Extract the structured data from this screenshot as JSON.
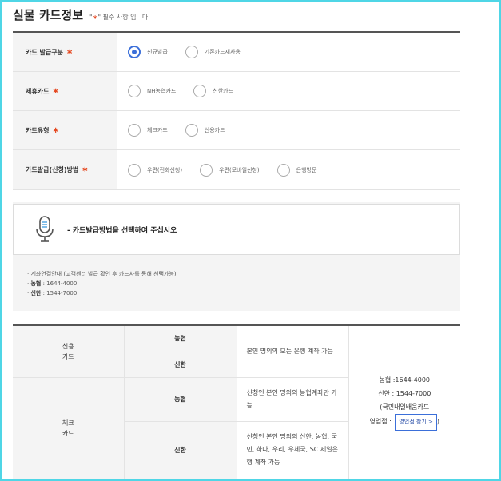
{
  "header": {
    "title": "실물 카드정보",
    "required_note_open": "\"",
    "required_note_star": "∗",
    "required_note_close": "\" 필수 사항 입니다."
  },
  "form": {
    "rows": [
      {
        "label": "카드 발급구분",
        "options": [
          "신규발급",
          "기존카드재사용"
        ],
        "selected": "신규발급"
      },
      {
        "label": "제휴카드",
        "options": [
          "NH농협카드",
          "신한카드"
        ]
      },
      {
        "label": "카드유형",
        "options": [
          "체크카드",
          "신용카드"
        ]
      },
      {
        "label": "카드발급(신청)방법",
        "options": [
          "우편(전화신청)",
          "우편(모바일신청)",
          "은행방문"
        ]
      }
    ],
    "required_mark": "∗"
  },
  "guide": {
    "message": "- 카드발급방법을 선택하여 주십시오",
    "notes": [
      {
        "prefix": "·",
        "text": "계좌연결안내 (고객센터 발급 확인 후 카드사를 통해 선택가능)"
      },
      {
        "prefix": "·",
        "bold": "농협",
        "text": " : 1644-4000"
      },
      {
        "prefix": "·",
        "bold": "신한",
        "text": " : 1544-7000"
      }
    ]
  },
  "table": {
    "credit": {
      "label_line1": "신용",
      "label_line2": "카드",
      "bank1": "농협",
      "bank2": "신한",
      "desc": "본인 명의의 모든 은행 계좌 가능"
    },
    "check": {
      "label_line1": "체크",
      "label_line2": "카드",
      "bank1": "농협",
      "desc1": "신청인 본인 명의의 농협계좌만 가능",
      "bank2": "신한",
      "desc2": "신청인 본인 명의의 신한, 농협, 국민, 하나, 우리, 우체국, SC 제일은행 계좌 가능"
    },
    "contact": {
      "line1": "농협 :1644-4000",
      "line2": "신한 : 1544-7000",
      "line3": "(국민내일배움카드",
      "branch_label": "영업점 :",
      "branch_button": "영업점 찾기 >",
      "close_paren": ")"
    }
  },
  "colors": {
    "accent": "#3b6fd9",
    "required": "#e5471f",
    "frame": "#4fd6e6"
  }
}
